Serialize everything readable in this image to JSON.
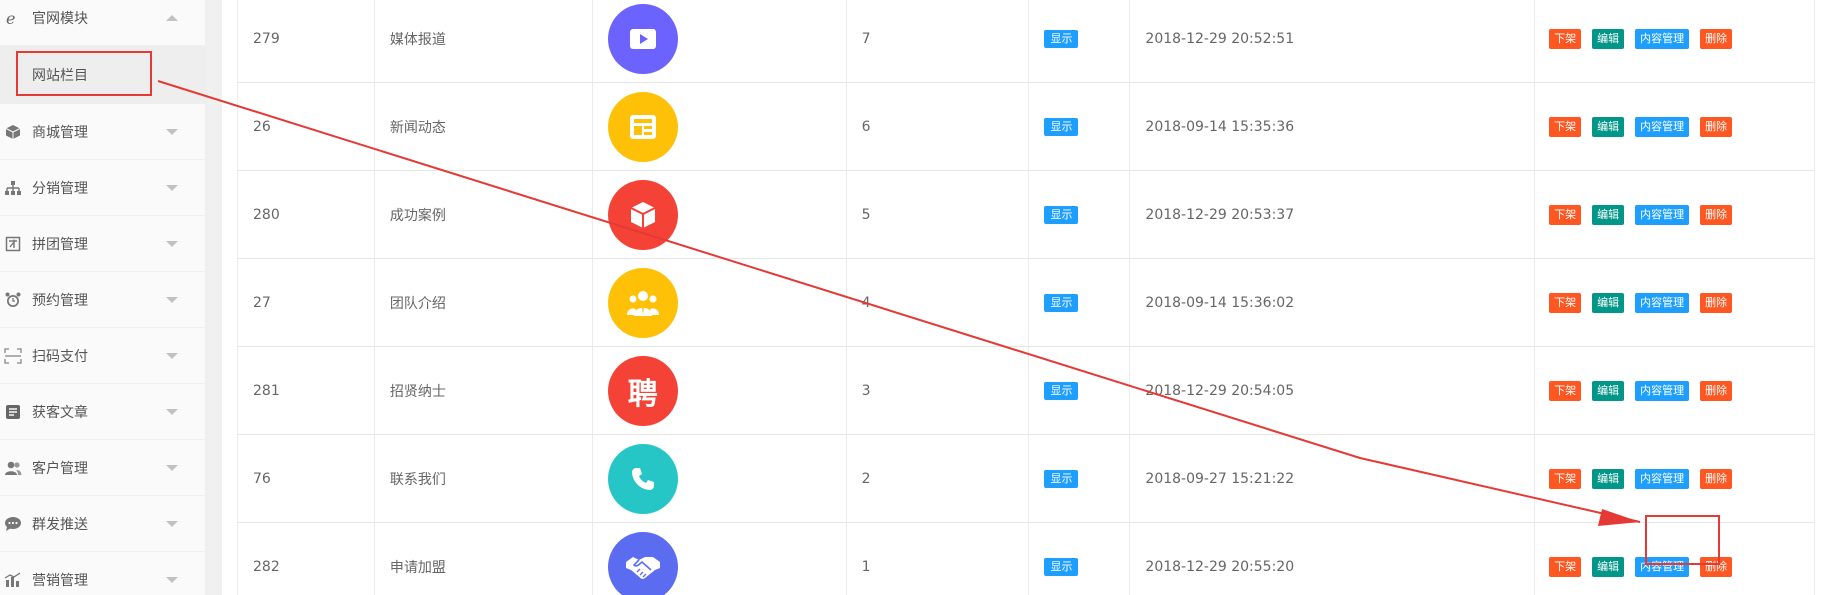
{
  "sidebar": {
    "groups": [
      {
        "label": "官网模块",
        "icon": "ie-icon",
        "expanded": true
      },
      {
        "label": "商城管理",
        "icon": "cube-icon"
      },
      {
        "label": "分销管理",
        "icon": "sitemap-icon"
      },
      {
        "label": "拼团管理",
        "icon": "tuan-icon"
      },
      {
        "label": "预约管理",
        "icon": "alarm-clock-icon"
      },
      {
        "label": "扫码支付",
        "icon": "scan-icon"
      },
      {
        "label": "获客文章",
        "icon": "article-icon"
      },
      {
        "label": "客户管理",
        "icon": "users-icon"
      },
      {
        "label": "群发推送",
        "icon": "chat-bubble-icon"
      },
      {
        "label": "营销管理",
        "icon": "bar-chart-icon"
      }
    ],
    "active_sub": "网站栏目"
  },
  "table": {
    "status_label": "显示",
    "actions": {
      "down": "下架",
      "edit": "编辑",
      "content": "内容管理",
      "delete": "删除"
    },
    "rows": [
      {
        "id": "279",
        "name": "媒体报道",
        "icon": "video-icon",
        "color": "#6c63ff",
        "sort": "7",
        "time": "2018-12-29 20:52:51"
      },
      {
        "id": "26",
        "name": "新闻动态",
        "icon": "news-icon",
        "color": "#ffc107",
        "sort": "6",
        "time": "2018-09-14 15:35:36"
      },
      {
        "id": "280",
        "name": "成功案例",
        "icon": "box-icon",
        "color": "#f44336",
        "sort": "5",
        "time": "2018-12-29 20:53:37"
      },
      {
        "id": "27",
        "name": "团队介绍",
        "icon": "team-icon",
        "color": "#ffc107",
        "sort": "4",
        "time": "2018-09-14 15:36:02"
      },
      {
        "id": "281",
        "name": "招贤纳士",
        "icon": "hire-icon",
        "color": "#f44336",
        "sort": "3",
        "time": "2018-12-29 20:54:05",
        "glyph": "聘"
      },
      {
        "id": "76",
        "name": "联系我们",
        "icon": "phone-icon",
        "color": "#26c6c6",
        "sort": "2",
        "time": "2018-09-27 15:21:22"
      },
      {
        "id": "282",
        "name": "申请加盟",
        "icon": "handshake-icon",
        "color": "#5b6cf0",
        "sort": "1",
        "time": "2018-12-29 20:55:20"
      }
    ]
  },
  "annotation": {
    "color": "#e53935"
  }
}
